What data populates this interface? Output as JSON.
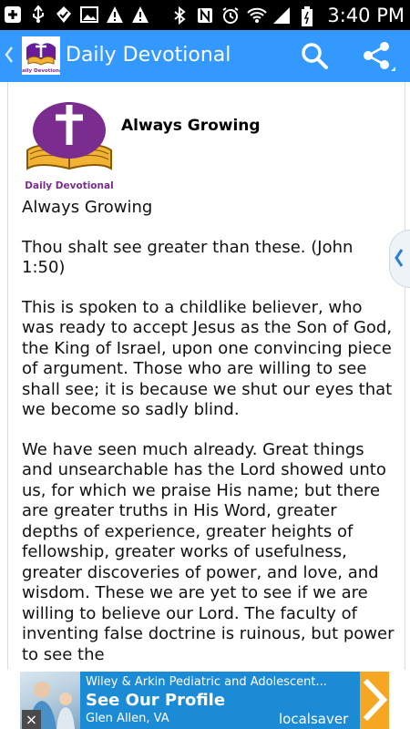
{
  "status_bar": {
    "time": "3:40 PM",
    "icons": [
      "add-icon",
      "usb-icon",
      "check-icon",
      "image-icon",
      "warning-icon",
      "warning-icon",
      "bluetooth-icon",
      "nfc-icon",
      "alarm-icon",
      "wifi-icon",
      "signal-icon",
      "battery-icon"
    ]
  },
  "action_bar": {
    "title": "Daily Devotional",
    "icons": [
      "app-logo-icon",
      "search-icon",
      "share-icon"
    ],
    "color": "#3399ff"
  },
  "devotional": {
    "logo_caption": "Daily Devotional",
    "heading": "Always Growing",
    "paragraphs": [
      "Always Growing",
      "Thou shalt see greater than these. (John 1:50)",
      "This is spoken to a childlike believer, who was ready to accept Jesus as the Son of God, the King of Israel, upon one convincing piece of argument. Those who are willing to see shall see; it is because we shut our eyes that we become so sadly blind.",
      "We have seen much already. Great things and unsearchable has the Lord showed unto us, for which we praise His name; but there are greater truths in His Word, greater depths of experience, greater heights of fellowship, greater works of usefulness, greater discoveries of power, and love, and wisdom. These we are yet to see if we are willing to believe our Lord. The faculty of inventing false doctrine is ruinous, but power to see the"
    ]
  },
  "drawer_handle": {
    "icon": "chevron-left-icon"
  },
  "ad": {
    "line1": "Wiley & Arkin Pediatric and Adolescent...",
    "line2": "See Our Profile",
    "line3": "Glen Allen, VA",
    "brand": "localsaver",
    "close_label": "×",
    "accent": "#1b8bd6",
    "arrow_color": "#f5a623"
  }
}
